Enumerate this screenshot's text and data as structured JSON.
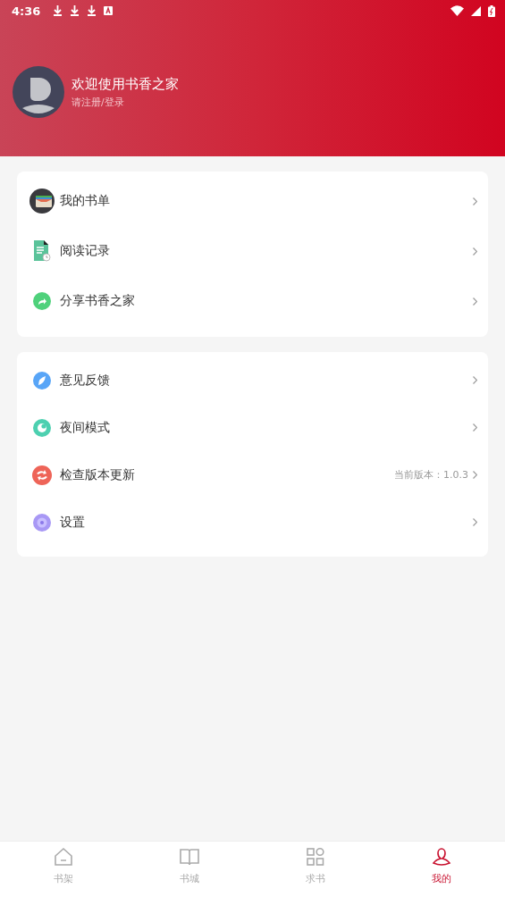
{
  "status_bar": {
    "time": "4:36"
  },
  "profile": {
    "title": "欢迎使用书香之家",
    "subtitle": "请注册/登录"
  },
  "menu_groups": [
    {
      "items": [
        {
          "label": "我的书单"
        },
        {
          "label": "阅读记录"
        },
        {
          "label": "分享书香之家"
        }
      ]
    },
    {
      "items": [
        {
          "label": "意见反馈"
        },
        {
          "label": "夜间模式"
        },
        {
          "label": "检查版本更新",
          "value": "当前版本：1.0.3"
        },
        {
          "label": "设置"
        }
      ]
    }
  ],
  "tabs": [
    {
      "label": "书架",
      "selected": false
    },
    {
      "label": "书城",
      "selected": false
    },
    {
      "label": "求书",
      "selected": false
    },
    {
      "label": "我的",
      "selected": true
    }
  ]
}
